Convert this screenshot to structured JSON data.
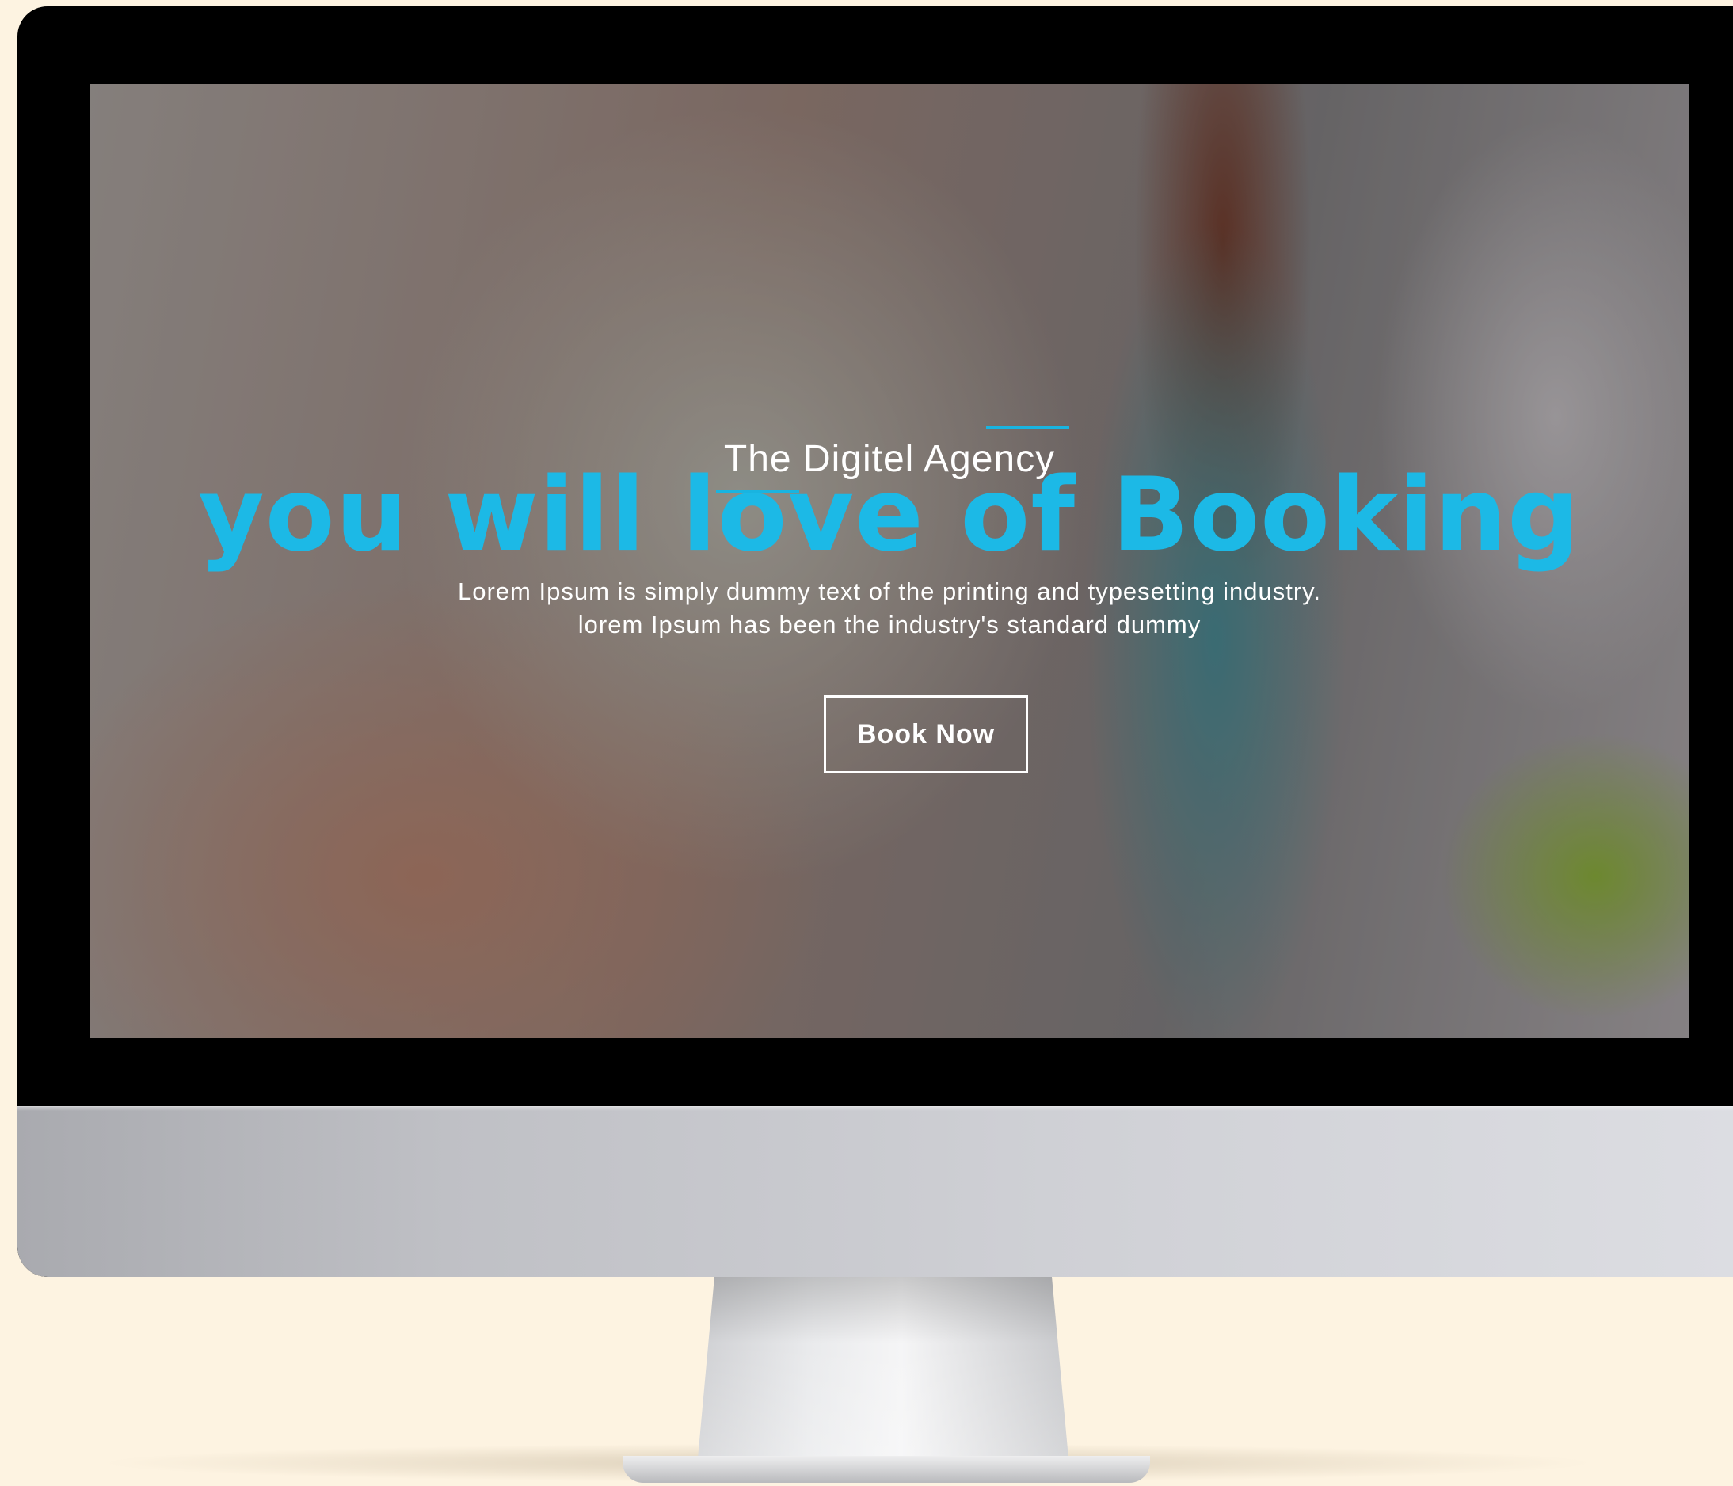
{
  "hero": {
    "agency_name": "The Digitel Agency",
    "headline": "you will love of Booking",
    "description_line1": "Lorem Ipsum is simply dummy text of the printing and typesetting industry.",
    "description_line2": "lorem Ipsum has been the industry's standard dummy",
    "cta_label": "Book Now"
  },
  "colors": {
    "accent": "#1cb9e6",
    "background": "#fdf3e1",
    "button_border": "#ffffff"
  }
}
